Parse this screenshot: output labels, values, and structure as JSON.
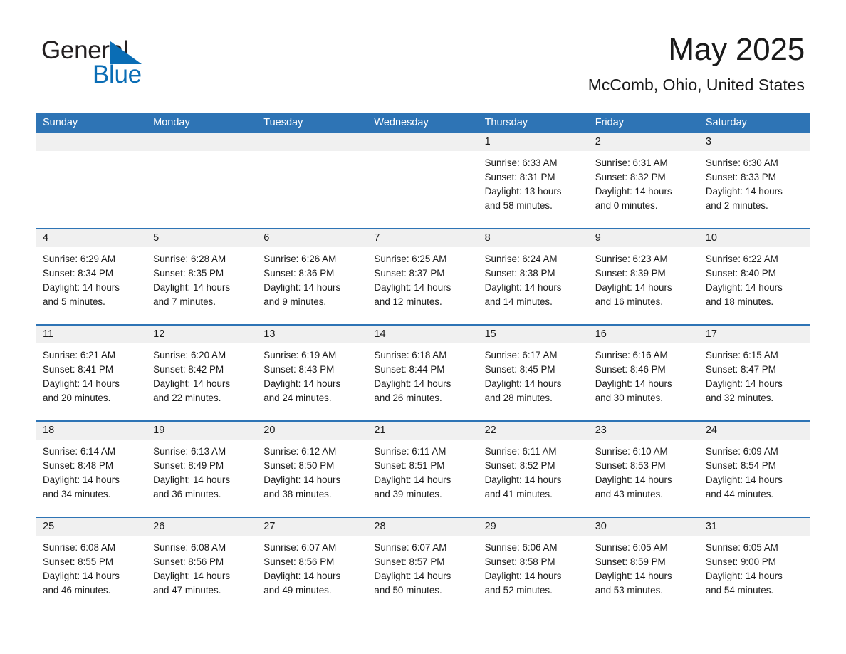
{
  "logo": {
    "word1": "General",
    "word2": "Blue",
    "triangle_icon": "blue-triangle-icon",
    "word1_color": "#231f20",
    "word2_color": "#0a6db5"
  },
  "header": {
    "title": "May 2025",
    "subtitle": "McComb, Ohio, United States"
  },
  "theme": {
    "header_blue": "#2e74b5",
    "day_strip_gray": "#f0f0f0",
    "text_color": "#1a1a1a"
  },
  "weekday_headers": [
    "Sunday",
    "Monday",
    "Tuesday",
    "Wednesday",
    "Thursday",
    "Friday",
    "Saturday"
  ],
  "weeks": [
    [
      {
        "day": "",
        "empty": true
      },
      {
        "day": "",
        "empty": true
      },
      {
        "day": "",
        "empty": true
      },
      {
        "day": "",
        "empty": true
      },
      {
        "day": "1",
        "sunrise": "Sunrise: 6:33 AM",
        "sunset": "Sunset: 8:31 PM",
        "daylight_line1": "Daylight: 13 hours",
        "daylight_line2": "and 58 minutes."
      },
      {
        "day": "2",
        "sunrise": "Sunrise: 6:31 AM",
        "sunset": "Sunset: 8:32 PM",
        "daylight_line1": "Daylight: 14 hours",
        "daylight_line2": "and 0 minutes."
      },
      {
        "day": "3",
        "sunrise": "Sunrise: 6:30 AM",
        "sunset": "Sunset: 8:33 PM",
        "daylight_line1": "Daylight: 14 hours",
        "daylight_line2": "and 2 minutes."
      }
    ],
    [
      {
        "day": "4",
        "sunrise": "Sunrise: 6:29 AM",
        "sunset": "Sunset: 8:34 PM",
        "daylight_line1": "Daylight: 14 hours",
        "daylight_line2": "and 5 minutes."
      },
      {
        "day": "5",
        "sunrise": "Sunrise: 6:28 AM",
        "sunset": "Sunset: 8:35 PM",
        "daylight_line1": "Daylight: 14 hours",
        "daylight_line2": "and 7 minutes."
      },
      {
        "day": "6",
        "sunrise": "Sunrise: 6:26 AM",
        "sunset": "Sunset: 8:36 PM",
        "daylight_line1": "Daylight: 14 hours",
        "daylight_line2": "and 9 minutes."
      },
      {
        "day": "7",
        "sunrise": "Sunrise: 6:25 AM",
        "sunset": "Sunset: 8:37 PM",
        "daylight_line1": "Daylight: 14 hours",
        "daylight_line2": "and 12 minutes."
      },
      {
        "day": "8",
        "sunrise": "Sunrise: 6:24 AM",
        "sunset": "Sunset: 8:38 PM",
        "daylight_line1": "Daylight: 14 hours",
        "daylight_line2": "and 14 minutes."
      },
      {
        "day": "9",
        "sunrise": "Sunrise: 6:23 AM",
        "sunset": "Sunset: 8:39 PM",
        "daylight_line1": "Daylight: 14 hours",
        "daylight_line2": "and 16 minutes."
      },
      {
        "day": "10",
        "sunrise": "Sunrise: 6:22 AM",
        "sunset": "Sunset: 8:40 PM",
        "daylight_line1": "Daylight: 14 hours",
        "daylight_line2": "and 18 minutes."
      }
    ],
    [
      {
        "day": "11",
        "sunrise": "Sunrise: 6:21 AM",
        "sunset": "Sunset: 8:41 PM",
        "daylight_line1": "Daylight: 14 hours",
        "daylight_line2": "and 20 minutes."
      },
      {
        "day": "12",
        "sunrise": "Sunrise: 6:20 AM",
        "sunset": "Sunset: 8:42 PM",
        "daylight_line1": "Daylight: 14 hours",
        "daylight_line2": "and 22 minutes."
      },
      {
        "day": "13",
        "sunrise": "Sunrise: 6:19 AM",
        "sunset": "Sunset: 8:43 PM",
        "daylight_line1": "Daylight: 14 hours",
        "daylight_line2": "and 24 minutes."
      },
      {
        "day": "14",
        "sunrise": "Sunrise: 6:18 AM",
        "sunset": "Sunset: 8:44 PM",
        "daylight_line1": "Daylight: 14 hours",
        "daylight_line2": "and 26 minutes."
      },
      {
        "day": "15",
        "sunrise": "Sunrise: 6:17 AM",
        "sunset": "Sunset: 8:45 PM",
        "daylight_line1": "Daylight: 14 hours",
        "daylight_line2": "and 28 minutes."
      },
      {
        "day": "16",
        "sunrise": "Sunrise: 6:16 AM",
        "sunset": "Sunset: 8:46 PM",
        "daylight_line1": "Daylight: 14 hours",
        "daylight_line2": "and 30 minutes."
      },
      {
        "day": "17",
        "sunrise": "Sunrise: 6:15 AM",
        "sunset": "Sunset: 8:47 PM",
        "daylight_line1": "Daylight: 14 hours",
        "daylight_line2": "and 32 minutes."
      }
    ],
    [
      {
        "day": "18",
        "sunrise": "Sunrise: 6:14 AM",
        "sunset": "Sunset: 8:48 PM",
        "daylight_line1": "Daylight: 14 hours",
        "daylight_line2": "and 34 minutes."
      },
      {
        "day": "19",
        "sunrise": "Sunrise: 6:13 AM",
        "sunset": "Sunset: 8:49 PM",
        "daylight_line1": "Daylight: 14 hours",
        "daylight_line2": "and 36 minutes."
      },
      {
        "day": "20",
        "sunrise": "Sunrise: 6:12 AM",
        "sunset": "Sunset: 8:50 PM",
        "daylight_line1": "Daylight: 14 hours",
        "daylight_line2": "and 38 minutes."
      },
      {
        "day": "21",
        "sunrise": "Sunrise: 6:11 AM",
        "sunset": "Sunset: 8:51 PM",
        "daylight_line1": "Daylight: 14 hours",
        "daylight_line2": "and 39 minutes."
      },
      {
        "day": "22",
        "sunrise": "Sunrise: 6:11 AM",
        "sunset": "Sunset: 8:52 PM",
        "daylight_line1": "Daylight: 14 hours",
        "daylight_line2": "and 41 minutes."
      },
      {
        "day": "23",
        "sunrise": "Sunrise: 6:10 AM",
        "sunset": "Sunset: 8:53 PM",
        "daylight_line1": "Daylight: 14 hours",
        "daylight_line2": "and 43 minutes."
      },
      {
        "day": "24",
        "sunrise": "Sunrise: 6:09 AM",
        "sunset": "Sunset: 8:54 PM",
        "daylight_line1": "Daylight: 14 hours",
        "daylight_line2": "and 44 minutes."
      }
    ],
    [
      {
        "day": "25",
        "sunrise": "Sunrise: 6:08 AM",
        "sunset": "Sunset: 8:55 PM",
        "daylight_line1": "Daylight: 14 hours",
        "daylight_line2": "and 46 minutes."
      },
      {
        "day": "26",
        "sunrise": "Sunrise: 6:08 AM",
        "sunset": "Sunset: 8:56 PM",
        "daylight_line1": "Daylight: 14 hours",
        "daylight_line2": "and 47 minutes."
      },
      {
        "day": "27",
        "sunrise": "Sunrise: 6:07 AM",
        "sunset": "Sunset: 8:56 PM",
        "daylight_line1": "Daylight: 14 hours",
        "daylight_line2": "and 49 minutes."
      },
      {
        "day": "28",
        "sunrise": "Sunrise: 6:07 AM",
        "sunset": "Sunset: 8:57 PM",
        "daylight_line1": "Daylight: 14 hours",
        "daylight_line2": "and 50 minutes."
      },
      {
        "day": "29",
        "sunrise": "Sunrise: 6:06 AM",
        "sunset": "Sunset: 8:58 PM",
        "daylight_line1": "Daylight: 14 hours",
        "daylight_line2": "and 52 minutes."
      },
      {
        "day": "30",
        "sunrise": "Sunrise: 6:05 AM",
        "sunset": "Sunset: 8:59 PM",
        "daylight_line1": "Daylight: 14 hours",
        "daylight_line2": "and 53 minutes."
      },
      {
        "day": "31",
        "sunrise": "Sunrise: 6:05 AM",
        "sunset": "Sunset: 9:00 PM",
        "daylight_line1": "Daylight: 14 hours",
        "daylight_line2": "and 54 minutes."
      }
    ]
  ]
}
